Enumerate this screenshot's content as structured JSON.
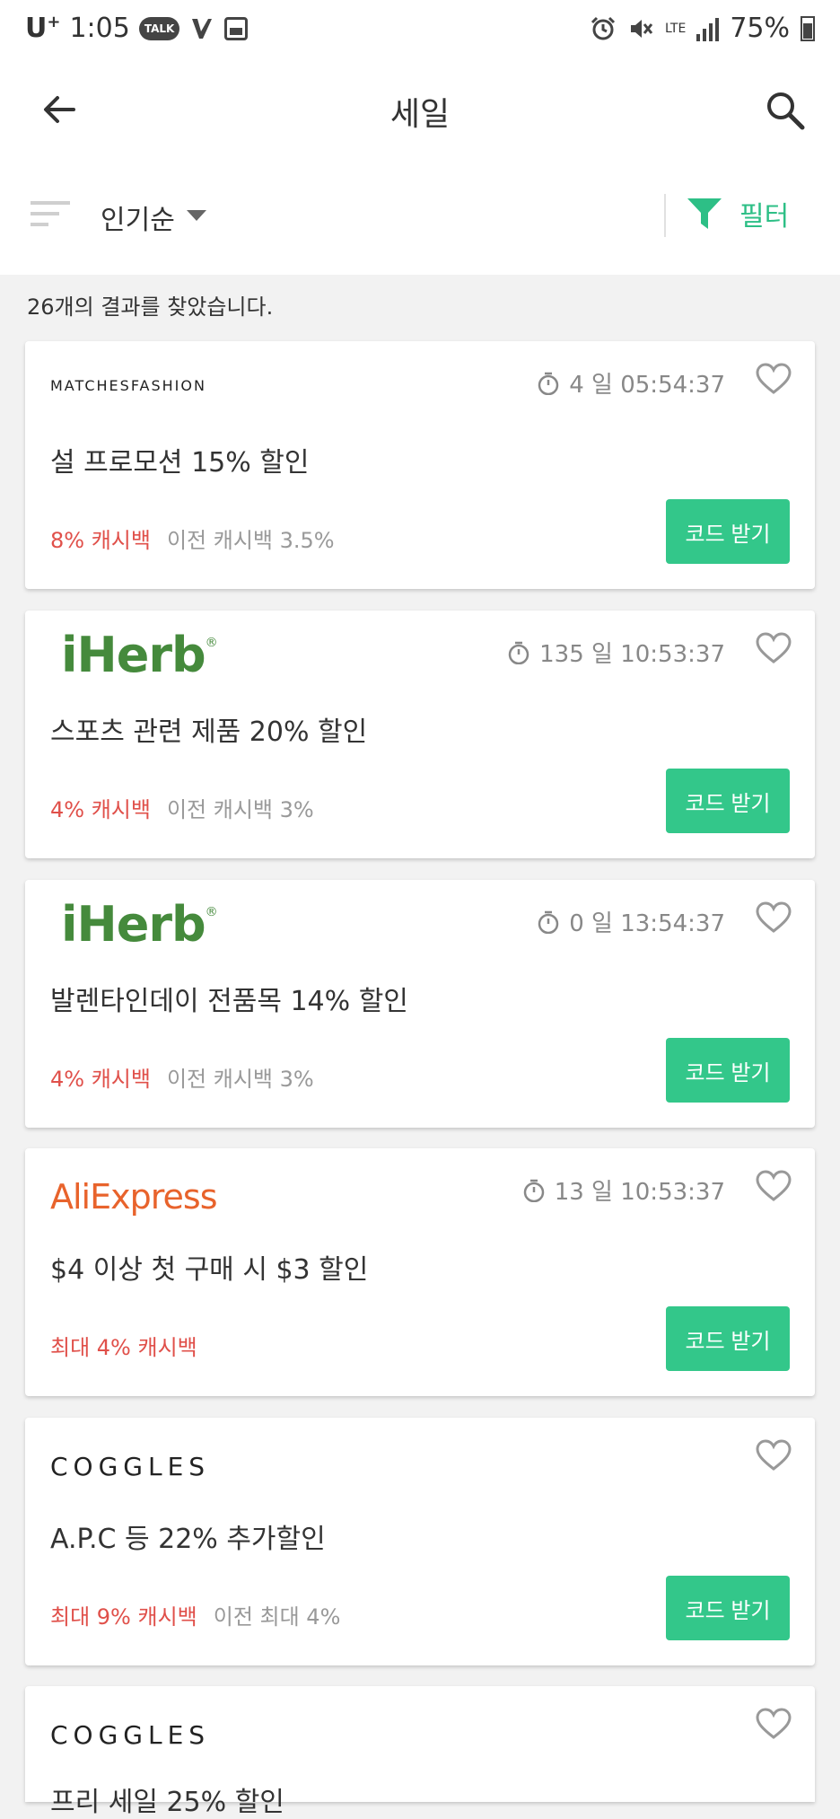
{
  "status_bar": {
    "carrier": "U",
    "carrier_sup": "+",
    "time": "1:05",
    "talk_label": "TALK",
    "network": "LTE",
    "battery": "75%"
  },
  "app_bar": {
    "title": "세일"
  },
  "sort_bar": {
    "sort_label": "인기순",
    "filter_label": "필터"
  },
  "results_text": "26개의 결과를 찾았습니다.",
  "colors": {
    "accent_green": "#33c78a",
    "cashback_red": "#e0504a",
    "iherb_green": "#458a3c",
    "aliexpress_orange": "#e8632c"
  },
  "offers": [
    {
      "brand": "MATCHESFASHION",
      "timer": "4 일 05:54:37",
      "title": "설 프로모션 15% 할인",
      "cashback": "8% 캐시백",
      "previous": "이전 캐시백 3.5%",
      "button": "코드 받기"
    },
    {
      "brand": "iHerb",
      "brand_mark": "®",
      "timer": "135 일 10:53:37",
      "title": "스포츠 관련 제품 20% 할인",
      "cashback": "4% 캐시백",
      "previous": "이전 캐시백 3%",
      "button": "코드 받기"
    },
    {
      "brand": "iHerb",
      "brand_mark": "®",
      "timer": "0 일 13:54:37",
      "title": "발렌타인데이 전품목 14% 할인",
      "cashback": "4% 캐시백",
      "previous": "이전 캐시백 3%",
      "button": "코드 받기"
    },
    {
      "brand": "AliExpress",
      "timer": "13 일 10:53:37",
      "title": "$4 이상 첫 구매 시 $3 할인",
      "cashback": "최대 4% 캐시백",
      "button": "코드 받기"
    },
    {
      "brand": "COGGLES",
      "title": "A.P.C 등 22% 추가할인",
      "cashback": "최대 9% 캐시백",
      "previous": "이전 최대 4%",
      "button": "코드 받기"
    },
    {
      "brand": "COGGLES",
      "title": "프리 세일 25% 할인"
    }
  ]
}
